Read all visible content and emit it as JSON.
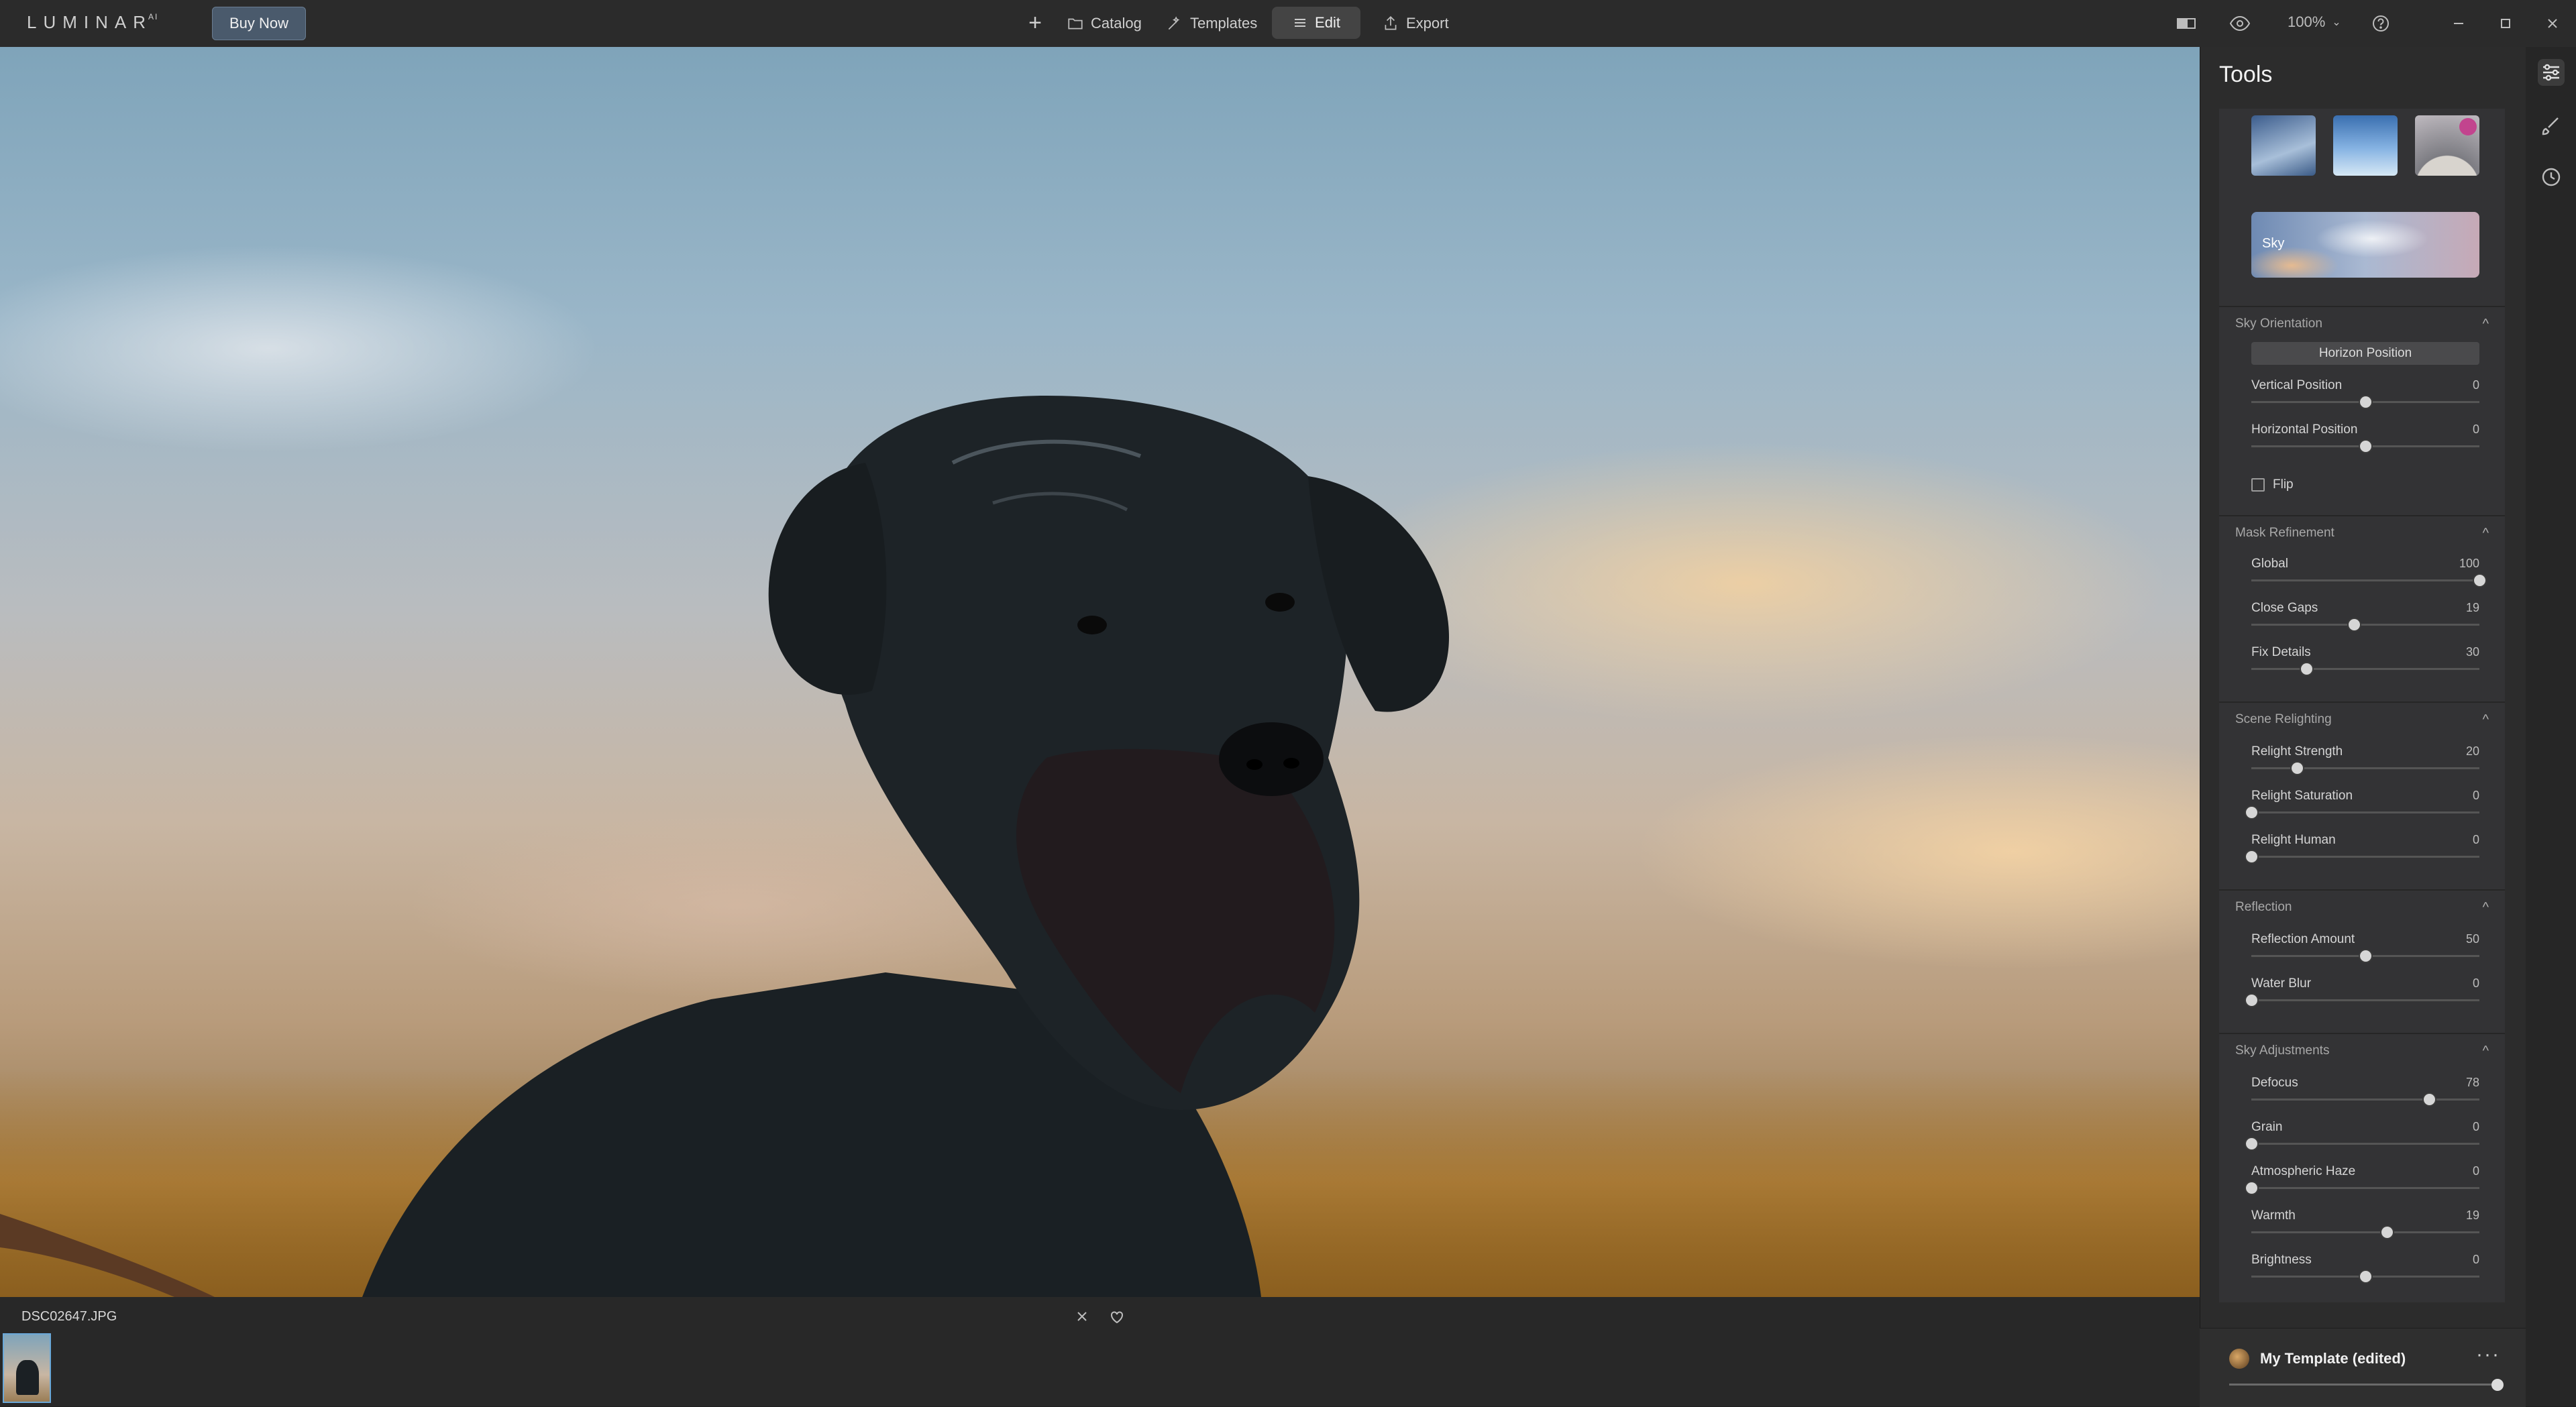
{
  "app": {
    "logo": "LUMINAR",
    "logo_suffix": "AI",
    "buy_label": "Buy Now"
  },
  "nav": {
    "catalog_label": "Catalog",
    "templates_label": "Templates",
    "edit_label": "Edit",
    "export_label": "Export"
  },
  "toolbar": {
    "zoom": "100%"
  },
  "filmstrip": {
    "filename": "DSC02647.JPG"
  },
  "panel": {
    "title": "Tools",
    "sky_label": "Sky",
    "sky_orientation": {
      "title": "Sky Orientation",
      "horizon_button": "Horizon Position",
      "sliders": [
        {
          "label": "Vertical Position",
          "value": "0",
          "pos": 0.5
        },
        {
          "label": "Horizontal Position",
          "value": "0",
          "pos": 0.5
        }
      ],
      "flip_label": "Flip"
    },
    "mask_refinement": {
      "title": "Mask Refinement",
      "sliders": [
        {
          "label": "Global",
          "value": "100",
          "pos": 1.0
        },
        {
          "label": "Close Gaps",
          "value": "19",
          "pos": 0.45
        },
        {
          "label": "Fix Details",
          "value": "30",
          "pos": 0.24
        }
      ]
    },
    "scene_relighting": {
      "title": "Scene Relighting",
      "sliders": [
        {
          "label": "Relight Strength",
          "value": "20",
          "pos": 0.2
        },
        {
          "label": "Relight Saturation",
          "value": "0",
          "pos": 0.0
        },
        {
          "label": "Relight Human",
          "value": "0",
          "pos": 0.0
        }
      ]
    },
    "reflection": {
      "title": "Reflection",
      "sliders": [
        {
          "label": "Reflection Amount",
          "value": "50",
          "pos": 0.5
        },
        {
          "label": "Water Blur",
          "value": "0",
          "pos": 0.0
        }
      ]
    },
    "sky_adjustments": {
      "title": "Sky Adjustments",
      "sliders": [
        {
          "label": "Defocus",
          "value": "78",
          "pos": 0.78
        },
        {
          "label": "Grain",
          "value": "0",
          "pos": 0.0
        },
        {
          "label": "Atmospheric Haze",
          "value": "0",
          "pos": 0.0
        },
        {
          "label": "Warmth",
          "value": "19",
          "pos": 0.595
        },
        {
          "label": "Brightness",
          "value": "0",
          "pos": 0.5
        }
      ]
    }
  },
  "template_bar": {
    "name": "My Template (edited)",
    "more_label": "···",
    "amount": 1.0
  },
  "colors": {
    "accent_blue": "#6aa8d8",
    "panel_bg": "#2c2c2c",
    "buy_bg": "#4a5a6c"
  }
}
